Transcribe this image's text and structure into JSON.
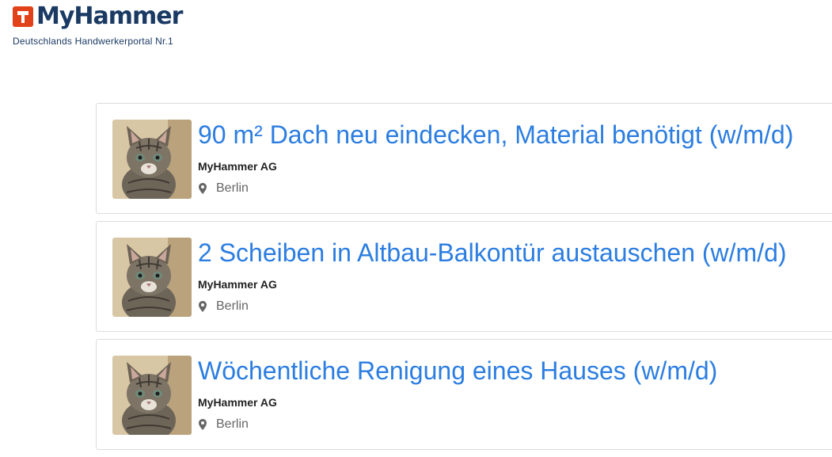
{
  "brand": {
    "name": "MyHammer",
    "tagline": "Deutschlands Handwerkerportal Nr.1",
    "logo_color": "#e2421a",
    "text_color": "#1a3a63"
  },
  "listings": [
    {
      "title": "90 m² Dach neu eindecken, Material benötigt (w/m/d)",
      "company": "MyHammer AG",
      "location": "Berlin",
      "image": "kitten-photo"
    },
    {
      "title": "2 Scheiben in Altbau-Balkontür austauschen (w/m/d)",
      "company": "MyHammer AG",
      "location": "Berlin",
      "image": "kitten-photo"
    },
    {
      "title": "Wöchentliche Renigung eines Hauses (w/m/d)",
      "company": "MyHammer AG",
      "location": "Berlin",
      "image": "kitten-photo"
    }
  ],
  "icons": {
    "location": "map-pin-icon"
  },
  "colors": {
    "title_link": "#2b7de1",
    "card_border": "#dcdcdc"
  }
}
